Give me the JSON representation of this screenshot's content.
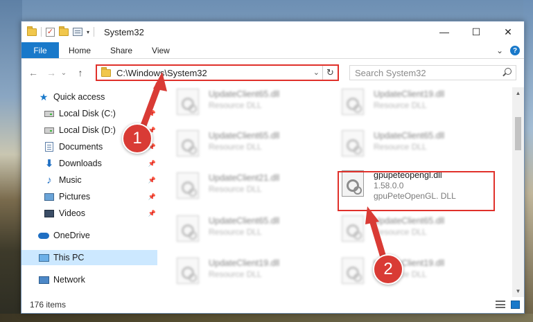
{
  "window": {
    "title": "System32",
    "controls": {
      "minimize": "—",
      "maximize": "☐",
      "close": "✕"
    }
  },
  "ribbon": {
    "file": "File",
    "tabs": [
      "Home",
      "Share",
      "View"
    ],
    "expand": "⌄",
    "help": "?"
  },
  "nav": {
    "back": "←",
    "forward": "→",
    "recent": "⌄",
    "up": "↑",
    "address": "C:\\Windows\\System32",
    "address_dropdown": "⌄",
    "refresh": "↻",
    "search_placeholder": "Search System32"
  },
  "sidebar": {
    "items": [
      {
        "label": "Quick access",
        "icon": "star-icon"
      },
      {
        "label": "Local Disk (C:)",
        "icon": "disk-icon",
        "pinned": true
      },
      {
        "label": "Local Disk (D:)",
        "icon": "disk-icon",
        "pinned": true
      },
      {
        "label": "Documents",
        "icon": "documents-icon",
        "pinned": true
      },
      {
        "label": "Downloads",
        "icon": "downloads-icon",
        "pinned": true
      },
      {
        "label": "Music",
        "icon": "music-icon",
        "pinned": true
      },
      {
        "label": "Pictures",
        "icon": "pictures-icon",
        "pinned": true
      },
      {
        "label": "Videos",
        "icon": "videos-icon",
        "pinned": true
      },
      {
        "label": "OneDrive",
        "icon": "onedrive-icon"
      },
      {
        "label": "This PC",
        "icon": "this-pc-icon",
        "selected": true
      },
      {
        "label": "Network",
        "icon": "network-icon"
      }
    ],
    "pin_glyph": "📌"
  },
  "files": [
    {
      "name": "UpdateClient65.dll",
      "sub": "Resource DLL"
    },
    {
      "name": "UpdateClient19.dll",
      "sub": "Resource DLL"
    },
    {
      "name": "UpdateClient65.dll",
      "sub": "Resource DLL"
    },
    {
      "name": "UpdateClient65.dll",
      "sub": "Resource DLL"
    },
    {
      "name": "UpdateClient21.dll",
      "sub": "Resource DLL"
    },
    {
      "name": "gpupeteopengl.dll",
      "version": "1.58.0.0",
      "sub": "gpuPeteOpenGL. DLL",
      "highlighted": true
    },
    {
      "name": "UpdateClient65.dll",
      "sub": "Resource DLL"
    },
    {
      "name": "UpdateClient65.dll",
      "sub": "Resource DLL"
    },
    {
      "name": "UpdateClient19.dll",
      "sub": "Resource DLL"
    },
    {
      "name": "UpdateClient19.dll",
      "sub": "Resource DLL"
    }
  ],
  "status": {
    "item_count": "176 items"
  },
  "annotations": {
    "step1": "1",
    "step2": "2",
    "color": "#d93b35"
  },
  "colors": {
    "accent": "#1979ca",
    "highlight_border": "#e0302a",
    "selected_bg": "#cce8ff"
  }
}
